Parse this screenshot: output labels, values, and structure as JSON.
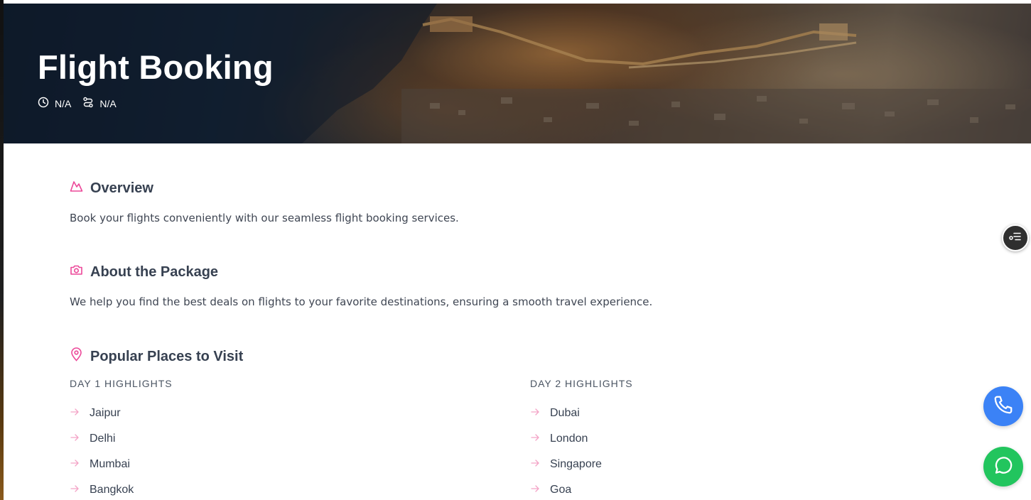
{
  "hero": {
    "title": "Flight Booking",
    "duration": "N/A",
    "route": "N/A"
  },
  "overview": {
    "title": "Overview",
    "text": "Book your flights conveniently with our seamless flight booking services."
  },
  "about": {
    "title": "About the Package",
    "text": "We help you find the best deals on flights to your favorite destinations, ensuring a smooth travel experience."
  },
  "places": {
    "title": "Popular Places to Visit",
    "days": [
      {
        "heading": "DAY 1 HIGHLIGHTS",
        "items": [
          "Jaipur",
          "Delhi",
          "Mumbai",
          "Bangkok"
        ]
      },
      {
        "heading": "DAY 2 HIGHLIGHTS",
        "items": [
          "Dubai",
          "London",
          "Singapore",
          "Goa"
        ]
      }
    ]
  },
  "colors": {
    "accent": "#ec4899",
    "text": "#374151",
    "call": "#3b82f6",
    "whatsapp": "#22c55e",
    "menu": "#2f2f2f"
  },
  "icons": {
    "overview": "mountain-icon",
    "about": "camera-icon",
    "places": "map-pin-icon",
    "duration": "clock-icon",
    "route": "route-icon",
    "list_bullet": "arrow-right-icon",
    "menu": "list-menu-icon",
    "call": "phone-icon",
    "chat": "whatsapp-icon"
  }
}
